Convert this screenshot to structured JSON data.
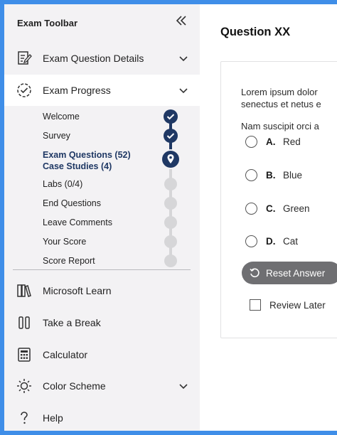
{
  "sidebar": {
    "title": "Exam Toolbar",
    "collapse_icon": "double-chevron-left-icon",
    "sections": {
      "details": {
        "label": "Exam Question Details",
        "icon": "document-edit-icon"
      },
      "progress": {
        "label": "Exam Progress",
        "icon": "dashed-circle-check-icon"
      }
    },
    "steps": [
      {
        "label": "Welcome",
        "status": "done"
      },
      {
        "label": "Survey",
        "status": "done"
      },
      {
        "label": "Exam Questions (52)",
        "label2": "Case Studies (4)",
        "status": "current"
      },
      {
        "label": "Labs (0/4)",
        "status": "todo"
      },
      {
        "label": "End Questions",
        "status": "todo"
      },
      {
        "label": "Leave Comments",
        "status": "todo"
      },
      {
        "label": "Your Score",
        "status": "todo"
      },
      {
        "label": "Score Report",
        "status": "todo"
      }
    ],
    "tools": {
      "learn": {
        "label": "Microsoft Learn",
        "icon": "book-icon"
      },
      "break": {
        "label": "Take a Break",
        "icon": "pause-icon"
      },
      "calculator": {
        "label": "Calculator",
        "icon": "calculator-icon"
      },
      "color_scheme": {
        "label": "Color Scheme",
        "icon": "sun-icon"
      },
      "help": {
        "label": "Help",
        "icon": "question-icon"
      }
    }
  },
  "main": {
    "question_title": "Question XX",
    "question_lines": [
      "Lorem ipsum dolor",
      "senectus et netus e",
      "Nam suscipit orci a"
    ],
    "options": [
      {
        "letter": "A.",
        "text": "Red"
      },
      {
        "letter": "B.",
        "text": "Blue"
      },
      {
        "letter": "C.",
        "text": "Green"
      },
      {
        "letter": "D.",
        "text": "Cat"
      }
    ],
    "reset_label": "Reset Answer",
    "review_label": "Review Later"
  },
  "colors": {
    "accent_navy": "#1f3864",
    "sidebar_bg": "#f3f2f4",
    "frame_blue": "#3f8ee8",
    "button_gray": "#6f6f72",
    "todo_gray": "#d6d6d8"
  }
}
